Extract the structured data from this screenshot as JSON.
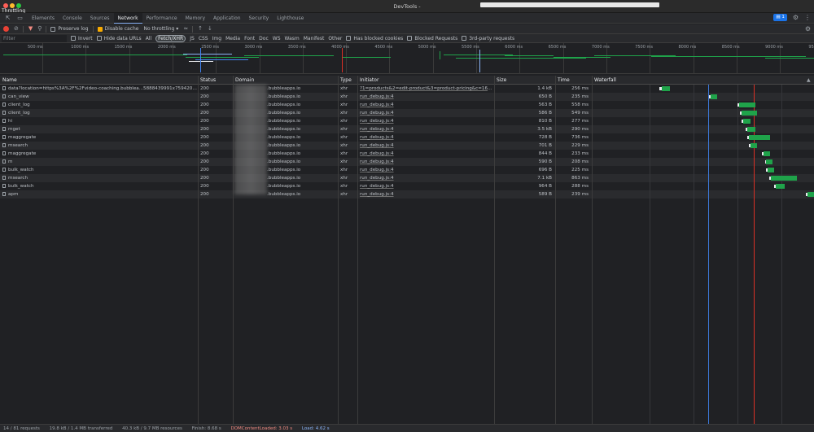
{
  "window": {
    "title": "DevTools -",
    "throttling_label": "Throttling"
  },
  "tabs": [
    {
      "label": "Elements",
      "active": false
    },
    {
      "label": "Console",
      "active": false
    },
    {
      "label": "Sources",
      "active": false
    },
    {
      "label": "Network",
      "active": true
    },
    {
      "label": "Performance",
      "active": false
    },
    {
      "label": "Memory",
      "active": false
    },
    {
      "label": "Application",
      "active": false
    },
    {
      "label": "Security",
      "active": false
    },
    {
      "label": "Lighthouse",
      "active": false
    }
  ],
  "issues_badge": "1",
  "toolbar": {
    "preserve_log": "Preserve log",
    "disable_cache": "Disable cache",
    "throttling": "No throttling"
  },
  "filter": {
    "placeholder": "Filter",
    "invert": "Invert",
    "hide_data_urls": "Hide data URLs",
    "types": [
      "All",
      "Fetch/XHR",
      "JS",
      "CSS",
      "Img",
      "Media",
      "Font",
      "Doc",
      "WS",
      "Wasm",
      "Manifest",
      "Other"
    ],
    "selected_type": "Fetch/XHR",
    "has_blocked_cookies": "Has blocked cookies",
    "blocked_requests": "Blocked Requests",
    "third_party": "3rd-party requests"
  },
  "overview": {
    "tick_labels": [
      "500 ms",
      "1000 ms",
      "1500 ms",
      "2000 ms",
      "2500 ms",
      "3000 ms",
      "3500 ms",
      "4000 ms",
      "4500 ms",
      "5000 ms",
      "5500 ms",
      "6000 ms",
      "6500 ms",
      "7000 ms",
      "7500 ms",
      "8000 ms",
      "8500 ms",
      "9000 ms",
      "950"
    ]
  },
  "columns": {
    "name": "Name",
    "status": "Status",
    "domain": "Domain",
    "type": "Type",
    "initiator": "Initiator",
    "size": "Size",
    "time": "Time",
    "waterfall": "Waterfall"
  },
  "rows": [
    {
      "name": "data?location=https%3A%2F%2Fvideo-coaching.bubblea...5888439991x7594205162...",
      "status": "200",
      "domain": ".bubbleapps.io",
      "type": "xhr",
      "initiator": "?1=products&2=edit-product&3=product-pricing&c=1645888...",
      "size": "1.4 kB",
      "time": "256 ms"
    },
    {
      "name": "can_view",
      "status": "200",
      "domain": ".bubbleapps.io",
      "type": "xhr",
      "initiator": "run_debug.js:4",
      "size": "650 B",
      "time": "235 ms"
    },
    {
      "name": "client_log",
      "status": "200",
      "domain": ".bubbleapps.io",
      "type": "xhr",
      "initiator": "run_debug.js:4",
      "size": "563 B",
      "time": "558 ms"
    },
    {
      "name": "client_log",
      "status": "200",
      "domain": ".bubbleapps.io",
      "type": "xhr",
      "initiator": "run_debug.js:4",
      "size": "586 B",
      "time": "549 ms"
    },
    {
      "name": "hi",
      "status": "200",
      "domain": ".bubbleapps.io",
      "type": "xhr",
      "initiator": "run_debug.js:4",
      "size": "810 B",
      "time": "277 ms"
    },
    {
      "name": "mget",
      "status": "200",
      "domain": ".bubbleapps.io",
      "type": "xhr",
      "initiator": "run_debug.js:4",
      "size": "3.5 kB",
      "time": "290 ms"
    },
    {
      "name": "maggregate",
      "status": "200",
      "domain": ".bubbleapps.io",
      "type": "xhr",
      "initiator": "run_debug.js:4",
      "size": "728 B",
      "time": "736 ms"
    },
    {
      "name": "msearch",
      "status": "200",
      "domain": ".bubbleapps.io",
      "type": "xhr",
      "initiator": "run_debug.js:4",
      "size": "701 B",
      "time": "229 ms"
    },
    {
      "name": "maggregate",
      "status": "200",
      "domain": ".bubbleapps.io",
      "type": "xhr",
      "initiator": "run_debug.js:4",
      "size": "844 B",
      "time": "233 ms"
    },
    {
      "name": "m",
      "status": "200",
      "domain": ".bubbleapps.io",
      "type": "xhr",
      "initiator": "run_debug.js:4",
      "size": "590 B",
      "time": "208 ms"
    },
    {
      "name": "bulk_watch",
      "status": "200",
      "domain": ".bubbleapps.io",
      "type": "xhr",
      "initiator": "run_debug.js:4",
      "size": "696 B",
      "time": "225 ms"
    },
    {
      "name": "msearch",
      "status": "200",
      "domain": ".bubbleapps.io",
      "type": "xhr",
      "initiator": "run_debug.js:4",
      "size": "7.1 kB",
      "time": "863 ms"
    },
    {
      "name": "bulk_watch",
      "status": "200",
      "domain": ".bubbleapps.io",
      "type": "xhr",
      "initiator": "run_debug.js:4",
      "size": "964 B",
      "time": "288 ms"
    },
    {
      "name": "apm",
      "status": "200",
      "domain": ".bubbleapps.io",
      "type": "xhr",
      "initiator": "run_debug.js:4",
      "size": "589 B",
      "time": "239 ms"
    }
  ],
  "status_bar": {
    "requests": "14 / 81 requests",
    "transferred": "19.8 kB / 1.4 MB transferred",
    "resources": "40.3 kB / 9.7 MB resources",
    "finish": "Finish: 8.68 s",
    "dcl": "DOMContentLoaded: 3.03 s",
    "load": "Load: 4.62 s"
  },
  "colors": {
    "accent": "#8ab4f8",
    "waterfall_bar": "#1fa34a",
    "dcl_line": "#3c78d8",
    "load_line": "#d93025"
  }
}
